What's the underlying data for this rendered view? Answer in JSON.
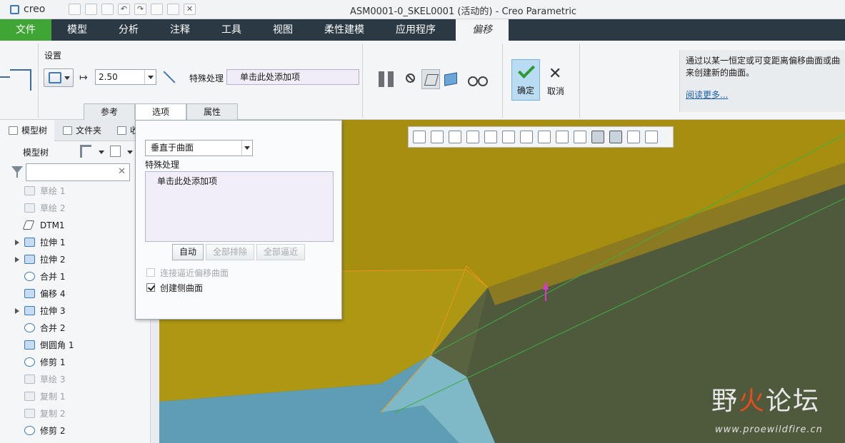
{
  "window": {
    "app_name": "creo",
    "title": "ASM0001-0_SKEL0001 (活动的) - Creo Parametric"
  },
  "ribbon_tabs": [
    "文件",
    "模型",
    "分析",
    "注释",
    "工具",
    "视图",
    "柔性建模",
    "应用程序",
    "偏移"
  ],
  "ribbon": {
    "settings_label": "设置",
    "distance_value": "2.50",
    "special_label": "特殊处理",
    "special_placeholder": "单击此处添加项",
    "subtabs": [
      "参考",
      "选项",
      "属性"
    ],
    "ok_label": "确定",
    "cancel_label": "取消",
    "help_text_line1": "通过以某一恒定或可变距离偏移曲面或曲线",
    "help_text_line2": "来创建新的曲面。",
    "help_more": "阅读更多..."
  },
  "left_pane": {
    "tabs": [
      "模型树",
      "文件夹",
      "收"
    ],
    "tree_title": "模型树",
    "search_value": "",
    "items": [
      {
        "label": "草绘 1",
        "dim": true,
        "expandable": false,
        "icon": "sketch-icon"
      },
      {
        "label": "草绘 2",
        "dim": true,
        "expandable": false,
        "icon": "sketch-icon"
      },
      {
        "label": "DTM1",
        "dim": false,
        "expandable": false,
        "icon": "datum-plane-icon"
      },
      {
        "label": "拉伸 1",
        "dim": false,
        "expandable": true,
        "icon": "extrude-icon"
      },
      {
        "label": "拉伸 2",
        "dim": false,
        "expandable": true,
        "icon": "extrude-icon"
      },
      {
        "label": "合并 1",
        "dim": false,
        "expandable": false,
        "icon": "merge-icon"
      },
      {
        "label": "偏移 4",
        "dim": false,
        "expandable": false,
        "icon": "offset-icon"
      },
      {
        "label": "拉伸 3",
        "dim": false,
        "expandable": true,
        "icon": "extrude-icon"
      },
      {
        "label": "合并 2",
        "dim": false,
        "expandable": false,
        "icon": "merge-icon"
      },
      {
        "label": "倒圆角 1",
        "dim": false,
        "expandable": false,
        "icon": "round-icon"
      },
      {
        "label": "修剪 1",
        "dim": false,
        "expandable": false,
        "icon": "trim-icon"
      },
      {
        "label": "草绘 3",
        "dim": true,
        "expandable": false,
        "icon": "sketch-icon"
      },
      {
        "label": "复制 1",
        "dim": true,
        "expandable": false,
        "icon": "copy-icon"
      },
      {
        "label": "复制 2",
        "dim": true,
        "expandable": false,
        "icon": "copy-icon"
      },
      {
        "label": "修剪 2",
        "dim": false,
        "expandable": false,
        "icon": "trim-icon"
      }
    ]
  },
  "options_panel": {
    "method": "垂直于曲面",
    "special_label": "特殊处理",
    "special_placeholder": "单击此处添加项",
    "buttons": [
      {
        "label": "自动",
        "enabled": true
      },
      {
        "label": "全部排除",
        "enabled": false
      },
      {
        "label": "全部逼近",
        "enabled": false
      }
    ],
    "checkbox_approx": {
      "label": "连接逼近偏移曲面",
      "checked": false,
      "enabled": false
    },
    "checkbox_side": {
      "label": "创建侧曲面",
      "checked": true,
      "enabled": true
    }
  },
  "watermark": {
    "text_a": "野",
    "text_b": "火",
    "text_c": "论坛",
    "url": "www.proewildfire.cn"
  },
  "colors": {
    "file_tab": "#3fa535",
    "tab_bar": "#2b3944",
    "surface_yellow": "#a08a10",
    "surface_blue": "#4f8ea6"
  }
}
